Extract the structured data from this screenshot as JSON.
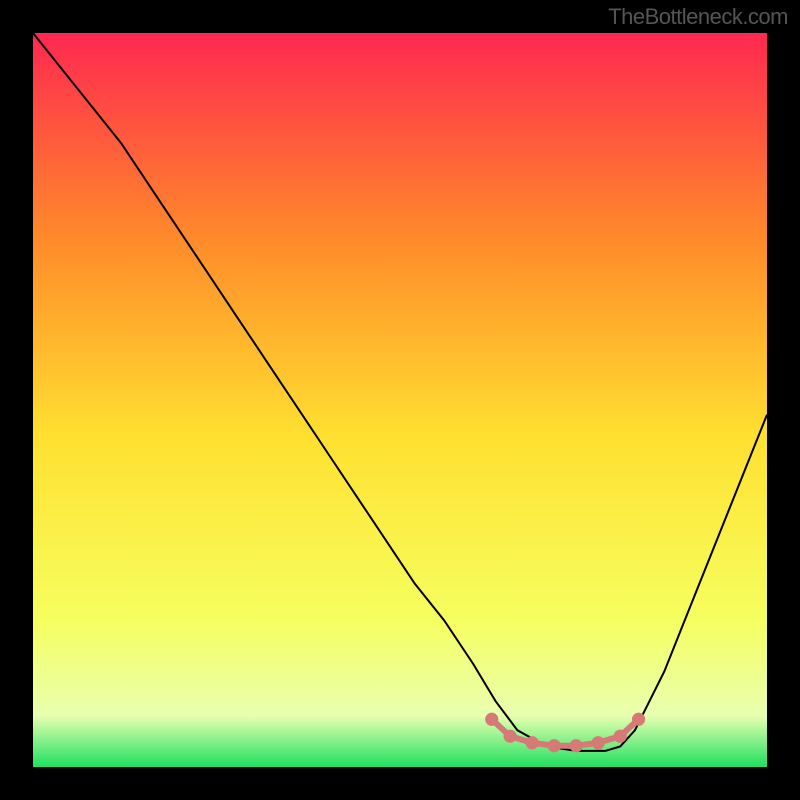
{
  "watermark": "TheBottleneck.com",
  "chart_data": {
    "type": "line",
    "title": "",
    "xlabel": "",
    "ylabel": "",
    "xlim": [
      0,
      100
    ],
    "ylim": [
      0,
      100
    ],
    "background_gradient": {
      "top": "#ff2850",
      "upper_mid": "#ff8a2a",
      "mid": "#ffe030",
      "lower_mid": "#f6ff60",
      "flat_band": "#e8ffb0",
      "bottom": "#20e060"
    },
    "curve": {
      "x": [
        0,
        4,
        8,
        12,
        16,
        20,
        24,
        28,
        32,
        36,
        40,
        44,
        48,
        52,
        56,
        60,
        63,
        66,
        70,
        74,
        78,
        80,
        82,
        86,
        90,
        94,
        98,
        100
      ],
      "y": [
        100,
        95,
        90,
        85,
        79,
        73,
        67,
        61,
        55,
        49,
        43,
        37,
        31,
        25,
        20,
        14,
        9,
        5,
        2.8,
        2.2,
        2.2,
        2.8,
        5,
        13,
        23,
        33,
        43,
        48
      ]
    },
    "optimal_marker": {
      "color": "#d67a78",
      "points": [
        {
          "x": 62.5,
          "y": 6.5
        },
        {
          "x": 65,
          "y": 4.2
        },
        {
          "x": 68,
          "y": 3.3
        },
        {
          "x": 71,
          "y": 2.9
        },
        {
          "x": 74,
          "y": 2.9
        },
        {
          "x": 77,
          "y": 3.3
        },
        {
          "x": 80,
          "y": 4.2
        },
        {
          "x": 82.5,
          "y": 6.5
        }
      ]
    }
  }
}
